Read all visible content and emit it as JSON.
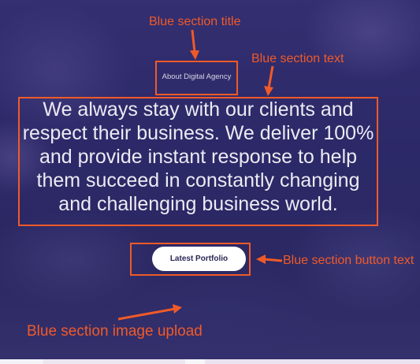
{
  "section": {
    "title": "About Digital Agency",
    "text": "We always stay with our clients and respect their business. We deliver 100% and provide instant response to help them succeed in constantly changing and challenging business world.",
    "button_label": "Latest Portfolio"
  },
  "annotations": {
    "title": "Blue section title",
    "text": "Blue section text",
    "button": "Blue section button text",
    "image": "Blue section image upload"
  },
  "colors": {
    "section_background": "#2f2b6a",
    "annotation": "#f05a28",
    "button_background": "#ffffff",
    "button_text": "#2b2756"
  }
}
